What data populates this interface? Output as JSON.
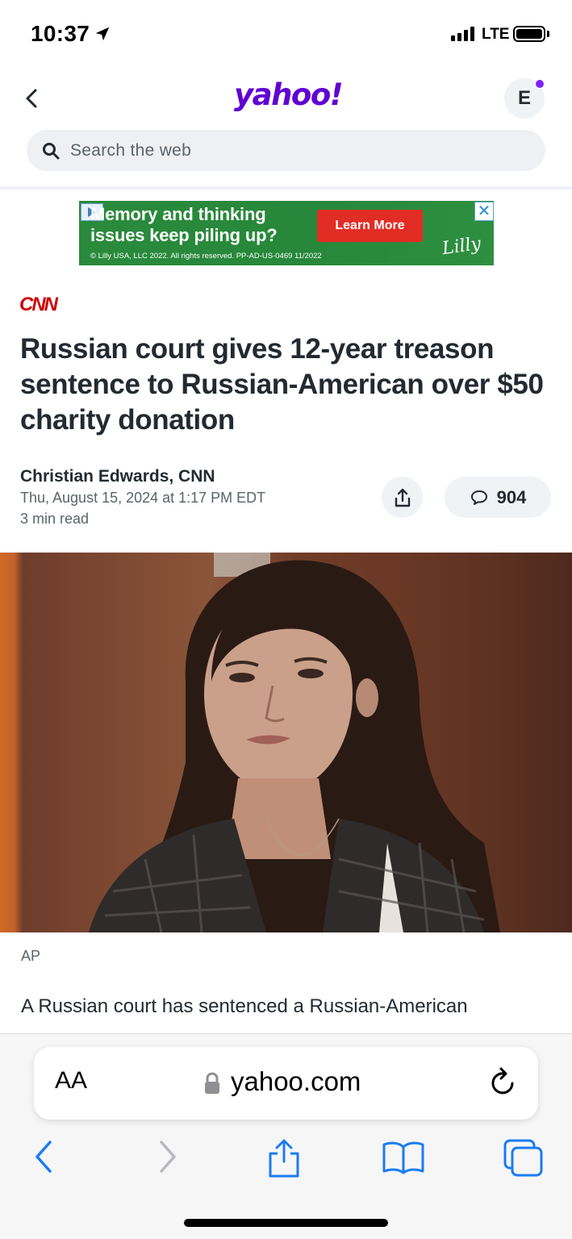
{
  "status_bar": {
    "time": "10:37",
    "network": "LTE",
    "icons": [
      "location-arrow-icon",
      "signal-bars-icon",
      "battery-icon"
    ]
  },
  "header": {
    "logo": "yahoo!",
    "avatar_initial": "E",
    "search_placeholder": "Search the web",
    "brand_color": "#6001d2"
  },
  "ad": {
    "headline_line1": "Memory and thinking",
    "headline_line2": "issues keep piling up?",
    "cta": "Learn More",
    "legal": "© Lilly USA, LLC 2022. All rights reserved. PP-AD-US-0469 11/2022",
    "brand": "Lilly",
    "close": "✕",
    "colors": {
      "background": "#2a8a3c",
      "cta": "#e22d25"
    }
  },
  "article": {
    "source": "CNN",
    "headline": "Russian court gives 12-year treason sentence to Russian-American over $50 charity donation",
    "author": "Christian Edwards, CNN",
    "date": "Thu, August 15, 2024 at 1:17 PM EDT",
    "read_time": "3 min read",
    "comment_count": "904",
    "photo_credit": "AP",
    "body_first_line": "A Russian court has sentenced a Russian-American"
  },
  "browser": {
    "text_size_label": "AA",
    "url": "yahoo.com",
    "toolbar_icons": [
      "back-icon",
      "forward-icon",
      "share-icon",
      "bookmarks-icon",
      "tabs-icon"
    ],
    "accent_color": "#1a7cf2"
  }
}
